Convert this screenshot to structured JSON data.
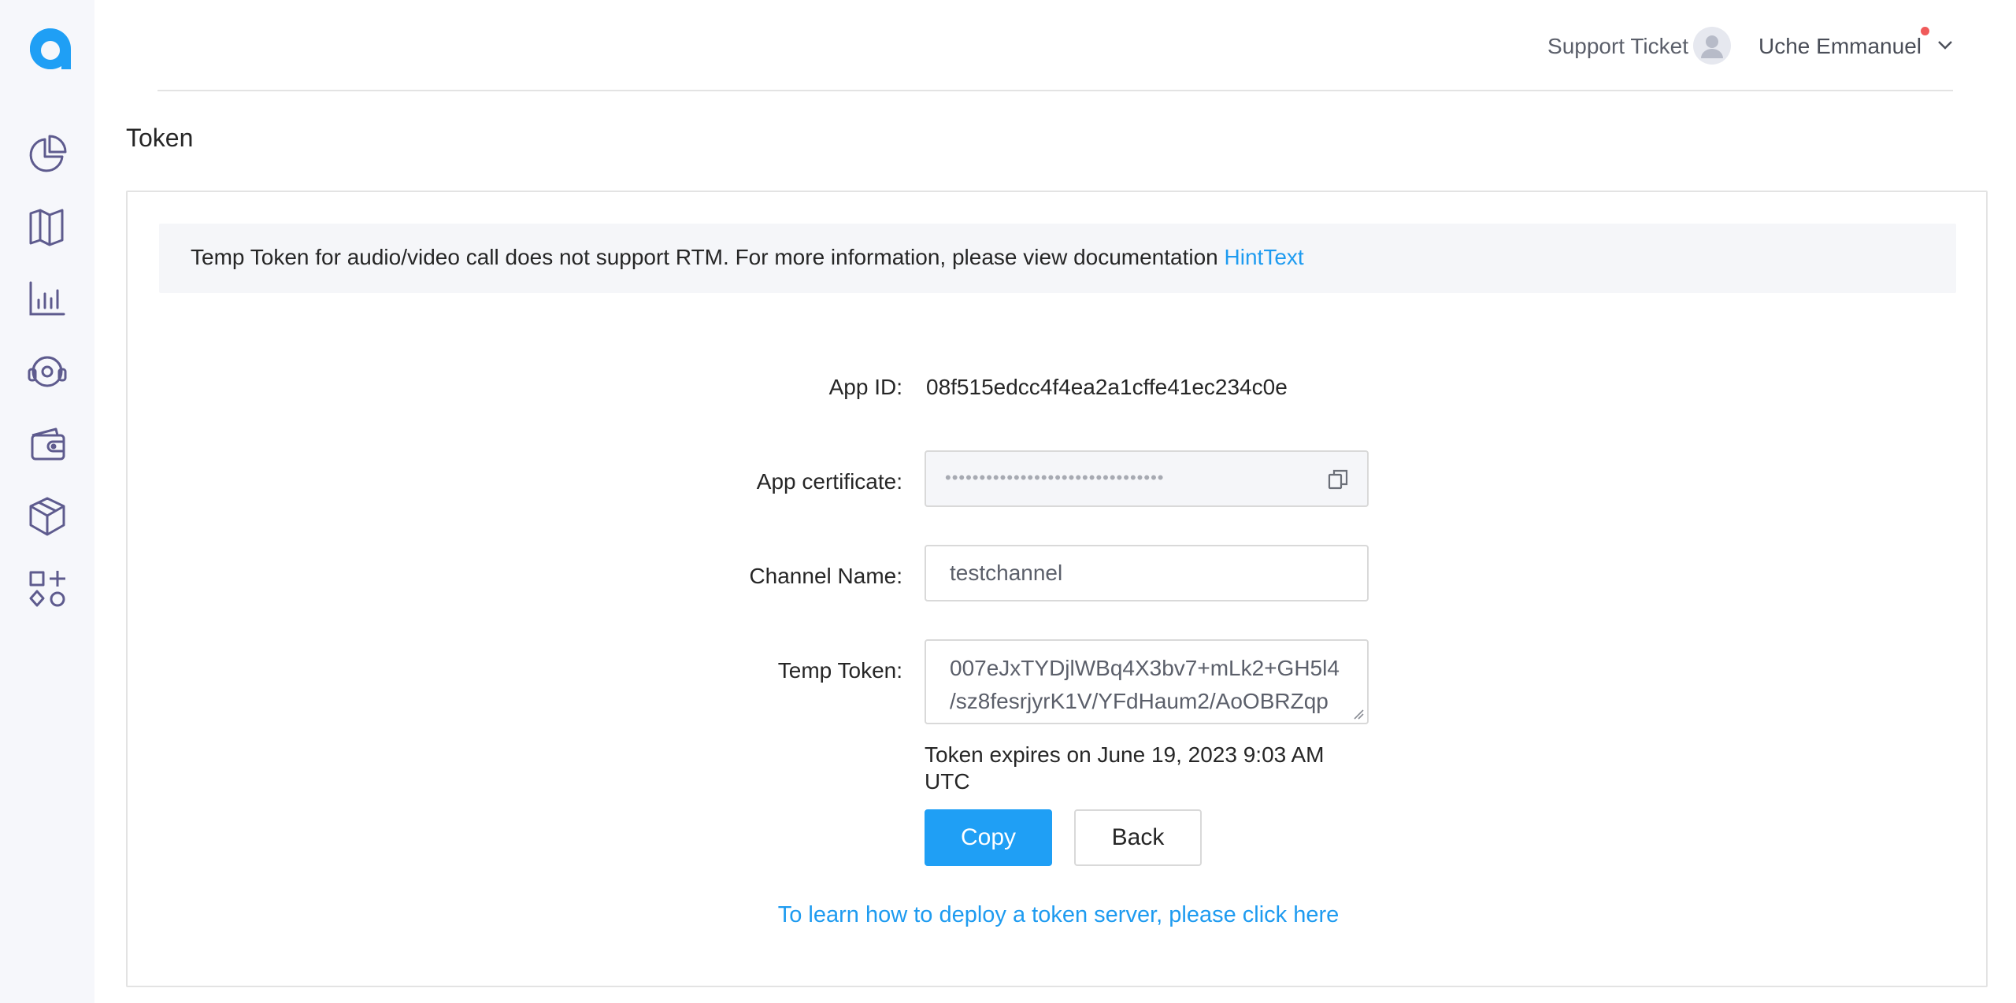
{
  "colors": {
    "accent": "#1f9ff5",
    "link": "#1e9bf0",
    "sidebar_bg": "#f6f7fb",
    "nav_icon": "#5e5b8e"
  },
  "sidebar": {
    "logo": "agora-logo-icon",
    "items": [
      {
        "icon": "pie-chart-icon"
      },
      {
        "icon": "map-icon"
      },
      {
        "icon": "bar-chart-icon"
      },
      {
        "icon": "headset-icon"
      },
      {
        "icon": "wallet-icon"
      },
      {
        "icon": "cube-icon"
      },
      {
        "icon": "shapes-icon"
      }
    ]
  },
  "header": {
    "support_label": "Support Ticket",
    "user_name": "Uche Emmanuel"
  },
  "page": {
    "title": "Token"
  },
  "hint": {
    "text": "Temp Token for audio/video call does not support RTM. For more information, please view documentation ",
    "link_text": "HintText"
  },
  "form": {
    "app_id_label": "App ID:",
    "app_id_value": "08f515edcc4f4ea2a1cffe41ec234c0e",
    "cert_label": "App certificate:",
    "cert_masked": "••••••••••••••••••••••••••••••••",
    "channel_label": "Channel Name:",
    "channel_value": "testchannel",
    "token_label": "Temp Token:",
    "token_line1": "007eJxTYDjlWBq4X3bv7+mLk2+GH5l4",
    "token_line2": "/sz8fesrjyrK1V/YFdHaum2/AoOBRZqp",
    "expires_text": "Token expires on June 19, 2023 9:03 AM UTC"
  },
  "buttons": {
    "copy_label": "Copy",
    "back_label": "Back"
  },
  "deploy_link": "To learn how to deploy a token server, please click here"
}
